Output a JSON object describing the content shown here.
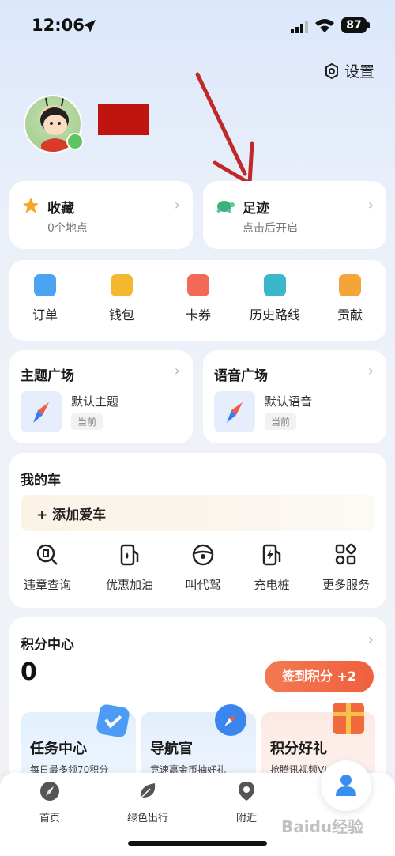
{
  "status": {
    "time": "12:06",
    "battery": "87"
  },
  "header": {
    "settings_label": "设置"
  },
  "favorites": {
    "title": "收藏",
    "subtitle": "0个地点"
  },
  "footprint": {
    "title": "足迹",
    "subtitle": "点击后开启"
  },
  "quick_actions": [
    {
      "label": "订单",
      "icon": "order-icon",
      "color": "#4aa3f3"
    },
    {
      "label": "钱包",
      "icon": "wallet-icon",
      "color": "#f5b630"
    },
    {
      "label": "卡券",
      "icon": "coupon-icon",
      "color": "#f26a55"
    },
    {
      "label": "历史路线",
      "icon": "route-icon",
      "color": "#3ab8c9"
    },
    {
      "label": "贡献",
      "icon": "contribute-icon",
      "color": "#f4a53a"
    }
  ],
  "theme_plaza": {
    "title": "主题广场",
    "item": "默认主题",
    "tag": "当前"
  },
  "voice_plaza": {
    "title": "语音广场",
    "item": "默认语音",
    "tag": "当前"
  },
  "my_car": {
    "title": "我的车",
    "add_car": "+ 添加爱车",
    "services": [
      {
        "label": "违章查询",
        "icon": "violation-search-icon"
      },
      {
        "label": "优惠加油",
        "icon": "fuel-icon"
      },
      {
        "label": "叫代驾",
        "icon": "steering-wheel-icon"
      },
      {
        "label": "充电桩",
        "icon": "charging-pile-icon"
      },
      {
        "label": "更多服务",
        "icon": "more-services-icon"
      }
    ]
  },
  "points_center": {
    "title": "积分中心",
    "points": "0",
    "sign_button": "签到积分 +2",
    "cards": [
      {
        "title": "任务中心",
        "subtitle": "每日最多领70积分"
      },
      {
        "title": "导航官",
        "subtitle": "竞速赢金币抽好礼"
      },
      {
        "title": "积分好礼",
        "subtitle": "抢腾讯视频VI"
      }
    ]
  },
  "tabbar": [
    {
      "label": "首页",
      "icon": "home-compass-icon"
    },
    {
      "label": "绿色出行",
      "icon": "leaf-icon"
    },
    {
      "label": "附近",
      "icon": "location-pin-icon"
    }
  ],
  "watermark": "Baidu经验",
  "colors": {
    "accent": "#f05f3e",
    "brand_blue": "#3a8df0"
  }
}
